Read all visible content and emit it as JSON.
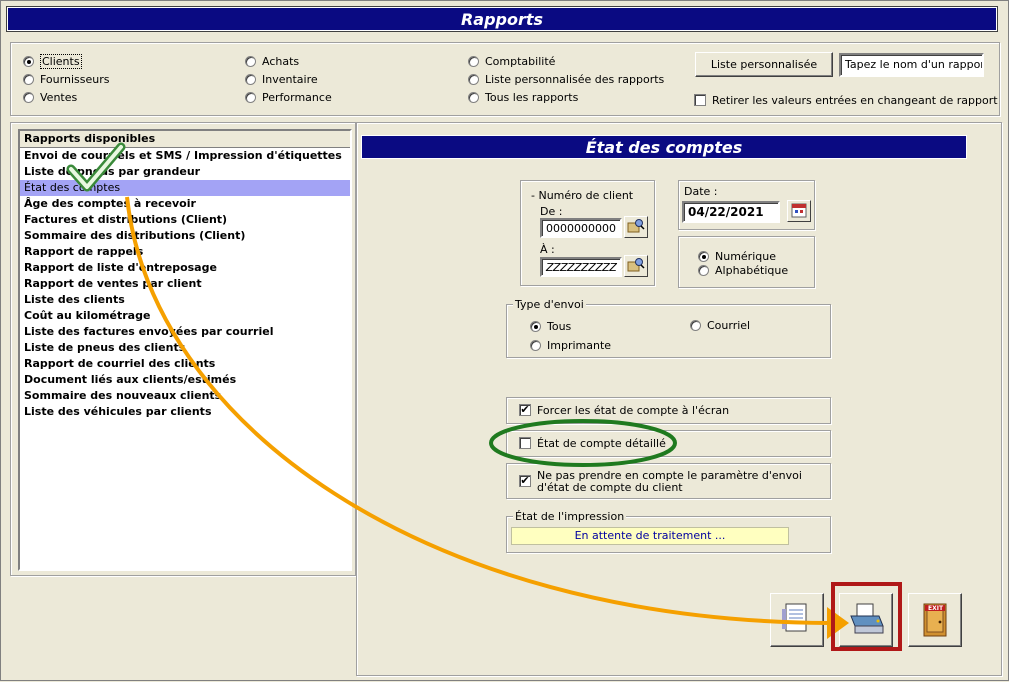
{
  "window": {
    "title": "Rapports"
  },
  "categories": {
    "col1": [
      {
        "label": "Clients",
        "selected": true
      },
      {
        "label": "Fournisseurs",
        "selected": false
      },
      {
        "label": "Ventes",
        "selected": false
      }
    ],
    "col2": [
      {
        "label": "Achats"
      },
      {
        "label": "Inventaire"
      },
      {
        "label": "Performance"
      }
    ],
    "col3": [
      {
        "label": "Comptabilité"
      },
      {
        "label": "Liste personnalisée des rapports"
      },
      {
        "label": "Tous les rapports"
      }
    ]
  },
  "custom_list_button": "Liste personnalisée",
  "report_name_input": {
    "value": "Tapez le nom d'un rapport"
  },
  "reset_values_checkbox": {
    "label": "Retirer les valeurs entrées en changeant de rapport"
  },
  "reports": {
    "header": "Rapports disponibles",
    "items": [
      "Envoi de courriels et SMS / Impression d'étiquettes",
      "Liste de pneus par grandeur",
      "État des comptes",
      "Âge des comptes à recevoir",
      "Factures et distributions (Client)",
      "Sommaire des distributions (Client)",
      "Rapport de rappels",
      "Rapport de liste d'entreposage",
      "Rapport de ventes par client",
      "Liste des clients",
      "Coût au kilométrage",
      "Liste des factures envoyées par courriel",
      "Liste de pneus des clients",
      "Rapport de courriel des clients",
      "Document liés aux clients/estimés",
      "Sommaire des nouveaux clients",
      "Liste des véhicules par clients"
    ],
    "active_index": 2
  },
  "detail": {
    "title": "État des comptes",
    "client_number": {
      "label": "- Numéro de client",
      "from_label": "De :",
      "from_value": "0000000000",
      "to_label": "À :",
      "to_value": "ZZZZZZZZZZ"
    },
    "date": {
      "label": "Date :",
      "value": "04/22/2021"
    },
    "sort": {
      "options": [
        "Numérique",
        "Alphabétique"
      ],
      "selected": 0
    },
    "send_type": {
      "label": "Type d'envoi",
      "options": [
        "Tous",
        "Courriel",
        "Imprimante"
      ],
      "selected": 0
    },
    "force_screen": {
      "label": "Forcer les état de compte à l'écran",
      "checked": true
    },
    "detailed": {
      "label": "État de compte détaillé",
      "checked": false
    },
    "ignore_param": {
      "label": "Ne pas prendre en compte le paramètre d'envoi d'état de compte du client",
      "checked": true
    },
    "print_status": {
      "label": "État de l'impression",
      "value": "En attente de traitement ..."
    }
  },
  "actions": {
    "exit_label": "EXIT"
  },
  "colors": {
    "title_bg": "#0a0a82",
    "selection": "#a3a3f5",
    "highlight_green": "#1f7a1f",
    "highlight_red": "#b01818",
    "arrow": "#f5a000"
  }
}
